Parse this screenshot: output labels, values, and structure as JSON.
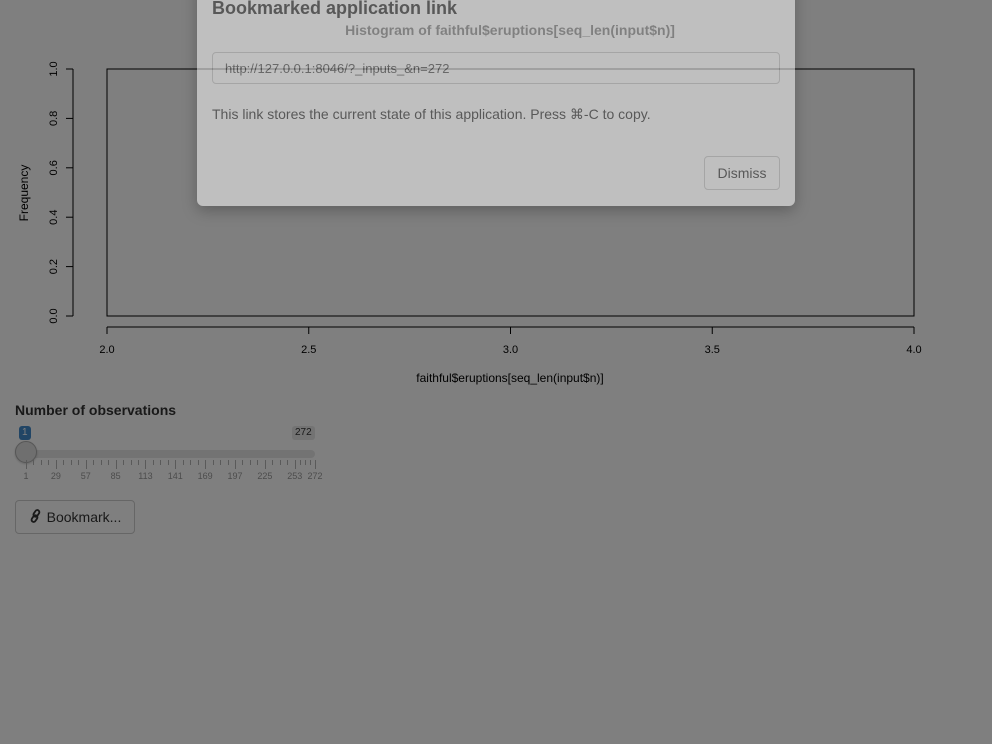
{
  "chart_data": {
    "type": "bar",
    "title": "Histogram of faithful$eruptions[seq_len(input$n)]",
    "xlabel": "faithful$eruptions[seq_len(input$n)]",
    "ylabel": "Frequency",
    "xlim": [
      2.0,
      4.0
    ],
    "ylim": [
      0.0,
      1.0
    ],
    "x_ticks": [
      "2.0",
      "2.5",
      "3.0",
      "3.5",
      "4.0"
    ],
    "y_ticks": [
      "0.0",
      "0.2",
      "0.4",
      "0.6",
      "0.8",
      "1.0"
    ],
    "bins": [
      {
        "from": 2.0,
        "to": 4.0,
        "count": 1
      }
    ]
  },
  "slider": {
    "label": "Number of observations",
    "min": "1",
    "max": "272",
    "value": "1",
    "value_fraction": 0,
    "grid_labels": [
      "1",
      "29",
      "57",
      "85",
      "113",
      "141",
      "169",
      "197",
      "225",
      "253",
      "272"
    ]
  },
  "bookmark_button": {
    "label": "Bookmark...",
    "icon": "link-icon"
  },
  "modal": {
    "title": "Bookmarked application link",
    "url": "http://127.0.0.1:8046/?_inputs_&n=272",
    "text": "This link stores the current state of this application. Press ⌘-C to copy.",
    "dismiss_label": "Dismiss"
  },
  "colors": {
    "accent": "#428bca",
    "backdrop": "#000000"
  }
}
